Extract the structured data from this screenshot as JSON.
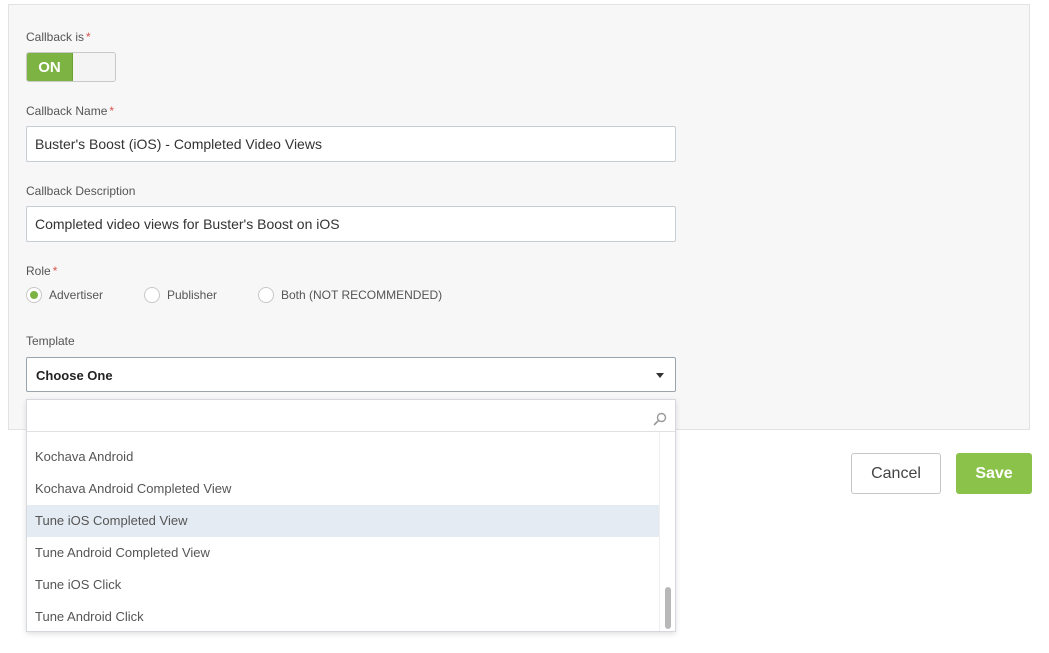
{
  "callback_toggle": {
    "label": "Callback is",
    "required_mark": "*",
    "state": "ON"
  },
  "callback_name": {
    "label": "Callback Name",
    "required_mark": "*",
    "value": "Buster's Boost (iOS) - Completed Video Views"
  },
  "callback_description": {
    "label": "Callback Description",
    "value": "Completed video views for Buster's Boost on iOS"
  },
  "role": {
    "label": "Role",
    "required_mark": "*",
    "options": [
      "Advertiser",
      "Publisher",
      "Both (NOT RECOMMENDED)"
    ],
    "selected": "Advertiser"
  },
  "template": {
    "label": "Template",
    "selected": "Choose One",
    "search_value": "",
    "options": [
      "Kochava Android",
      "Kochava Android Completed View",
      "Tune iOS Completed View",
      "Tune Android Completed View",
      "Tune iOS Click",
      "Tune Android Click"
    ],
    "highlighted": "Tune iOS Completed View"
  },
  "actions": {
    "cancel_label": "Cancel",
    "save_label": "Save"
  },
  "colors": {
    "accent": "#7cb342",
    "save_button": "#8bc34a",
    "required": "#d9534f",
    "highlight": "#e4ebf2"
  },
  "icons": {
    "search": "search-icon",
    "dropdown": "chevron-down-icon"
  }
}
